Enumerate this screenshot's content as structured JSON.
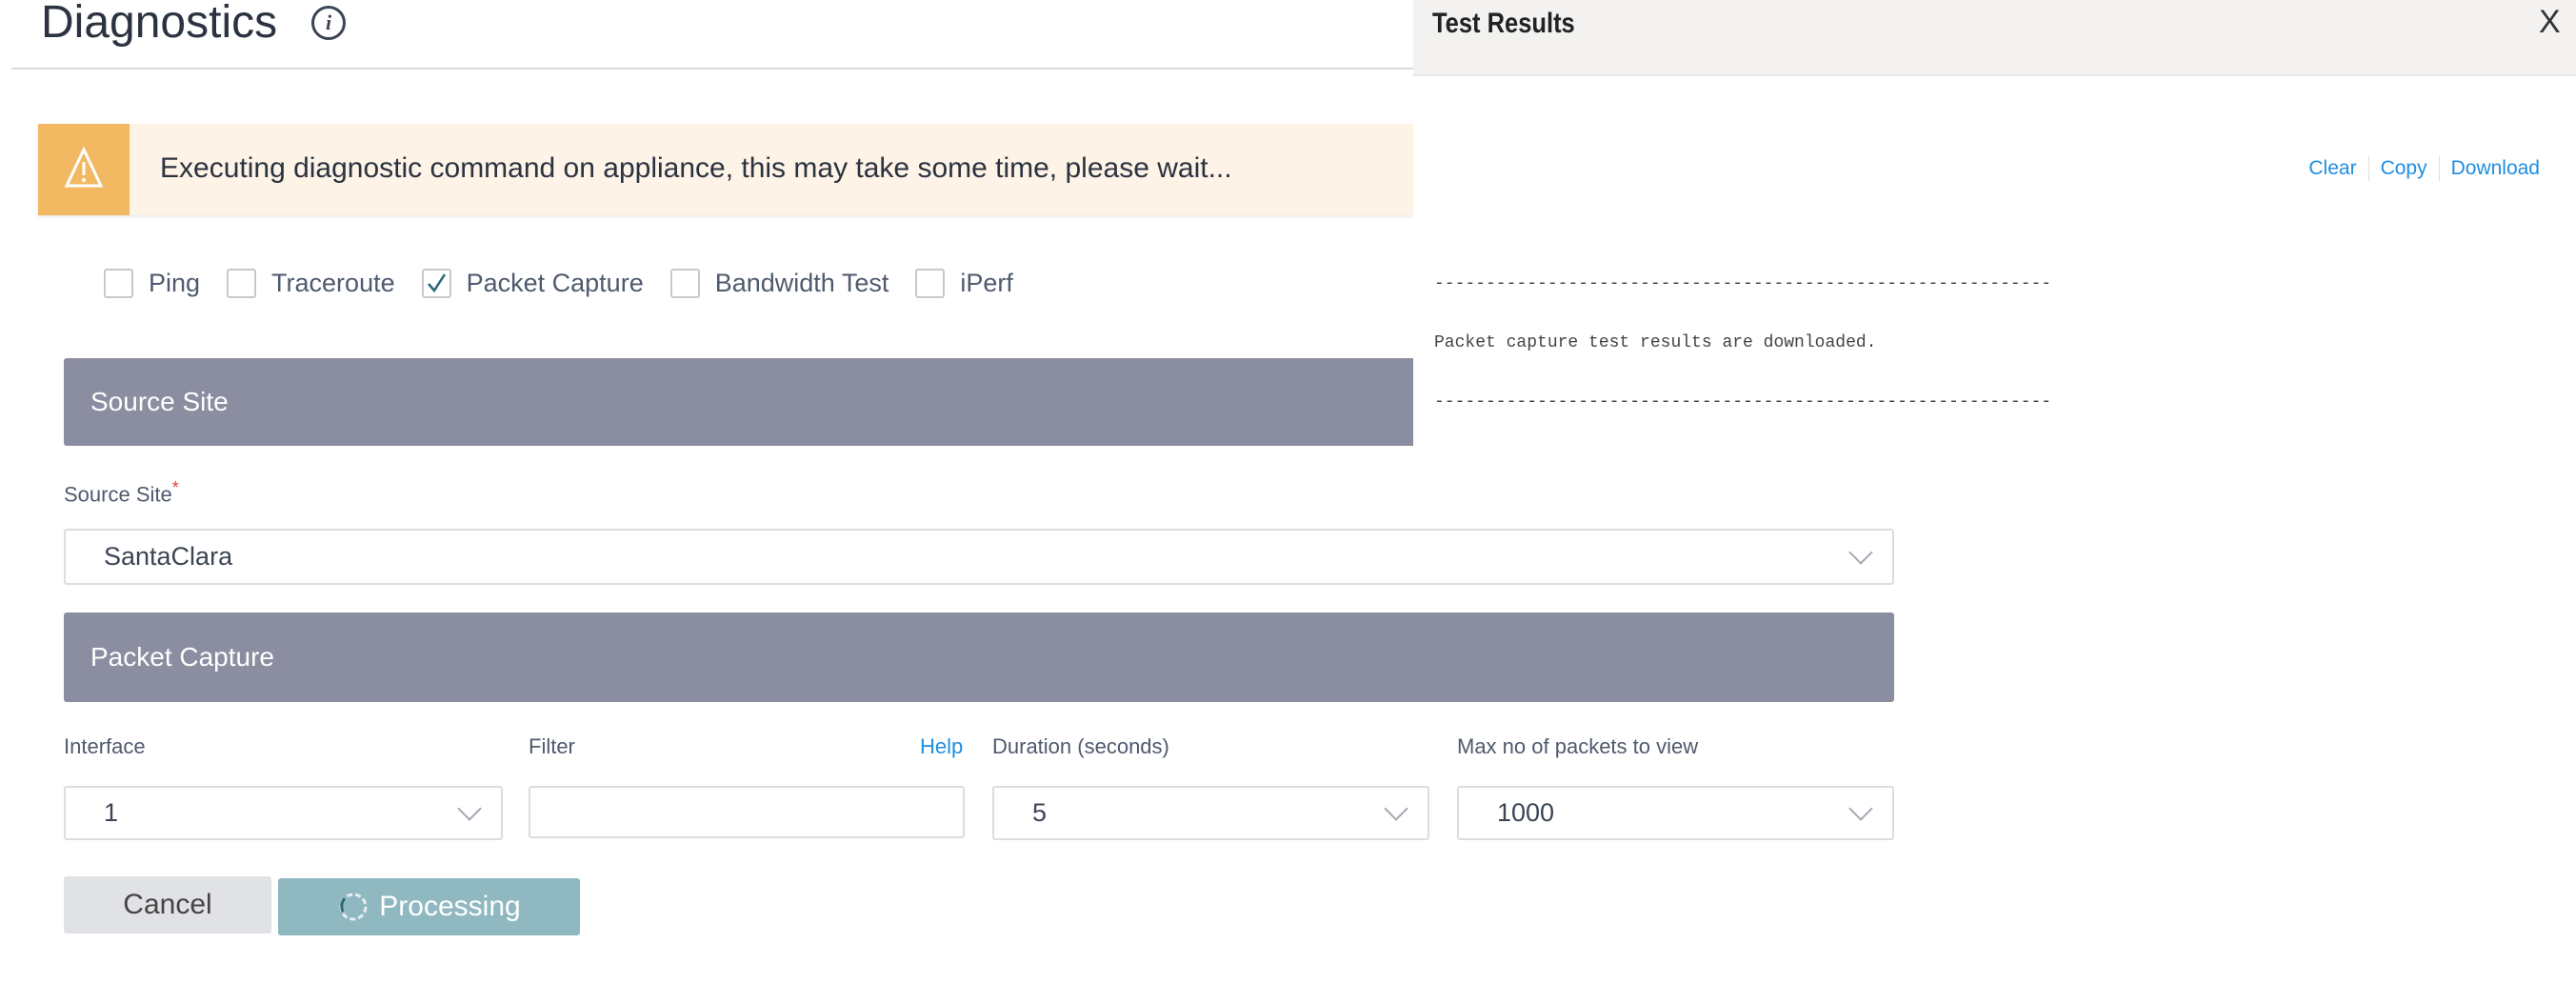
{
  "header": {
    "title": "Diagnostics",
    "info_icon": "info-icon"
  },
  "alert": {
    "icon": "warning-icon",
    "message": "Executing diagnostic command on appliance, this may take some time, please wait...",
    "accent": "#f2b862",
    "background": "#fdf3e6"
  },
  "tests": [
    {
      "label": "Ping",
      "checked": false
    },
    {
      "label": "Traceroute",
      "checked": false
    },
    {
      "label": "Packet Capture",
      "checked": true
    },
    {
      "label": "Bandwidth Test",
      "checked": false
    },
    {
      "label": "iPerf",
      "checked": false
    }
  ],
  "source_section": {
    "title": "Source Site",
    "field_label": "Source Site",
    "required_mark": "*",
    "value": "SantaClara"
  },
  "capture_section": {
    "title": "Packet Capture",
    "interface": {
      "label": "Interface",
      "value": "1"
    },
    "filter": {
      "label": "Filter",
      "value": "",
      "help": "Help"
    },
    "duration": {
      "label": "Duration (seconds)",
      "value": "5"
    },
    "max_packets": {
      "label": "Max no of packets to view",
      "value": "1000"
    }
  },
  "actions": {
    "cancel": "Cancel",
    "processing": "Processing"
  },
  "results": {
    "title": "Test Results",
    "close": "X",
    "clear": "Clear",
    "copy": "Copy",
    "download": "Download",
    "lines": [
      "------------------------------------------------------------",
      "Packet capture test results are downloaded.",
      "------------------------------------------------------------"
    ]
  },
  "colors": {
    "section_bar": "#8b8ea0",
    "link": "#1e8ee0",
    "processing_button": "#8fb8c1"
  }
}
